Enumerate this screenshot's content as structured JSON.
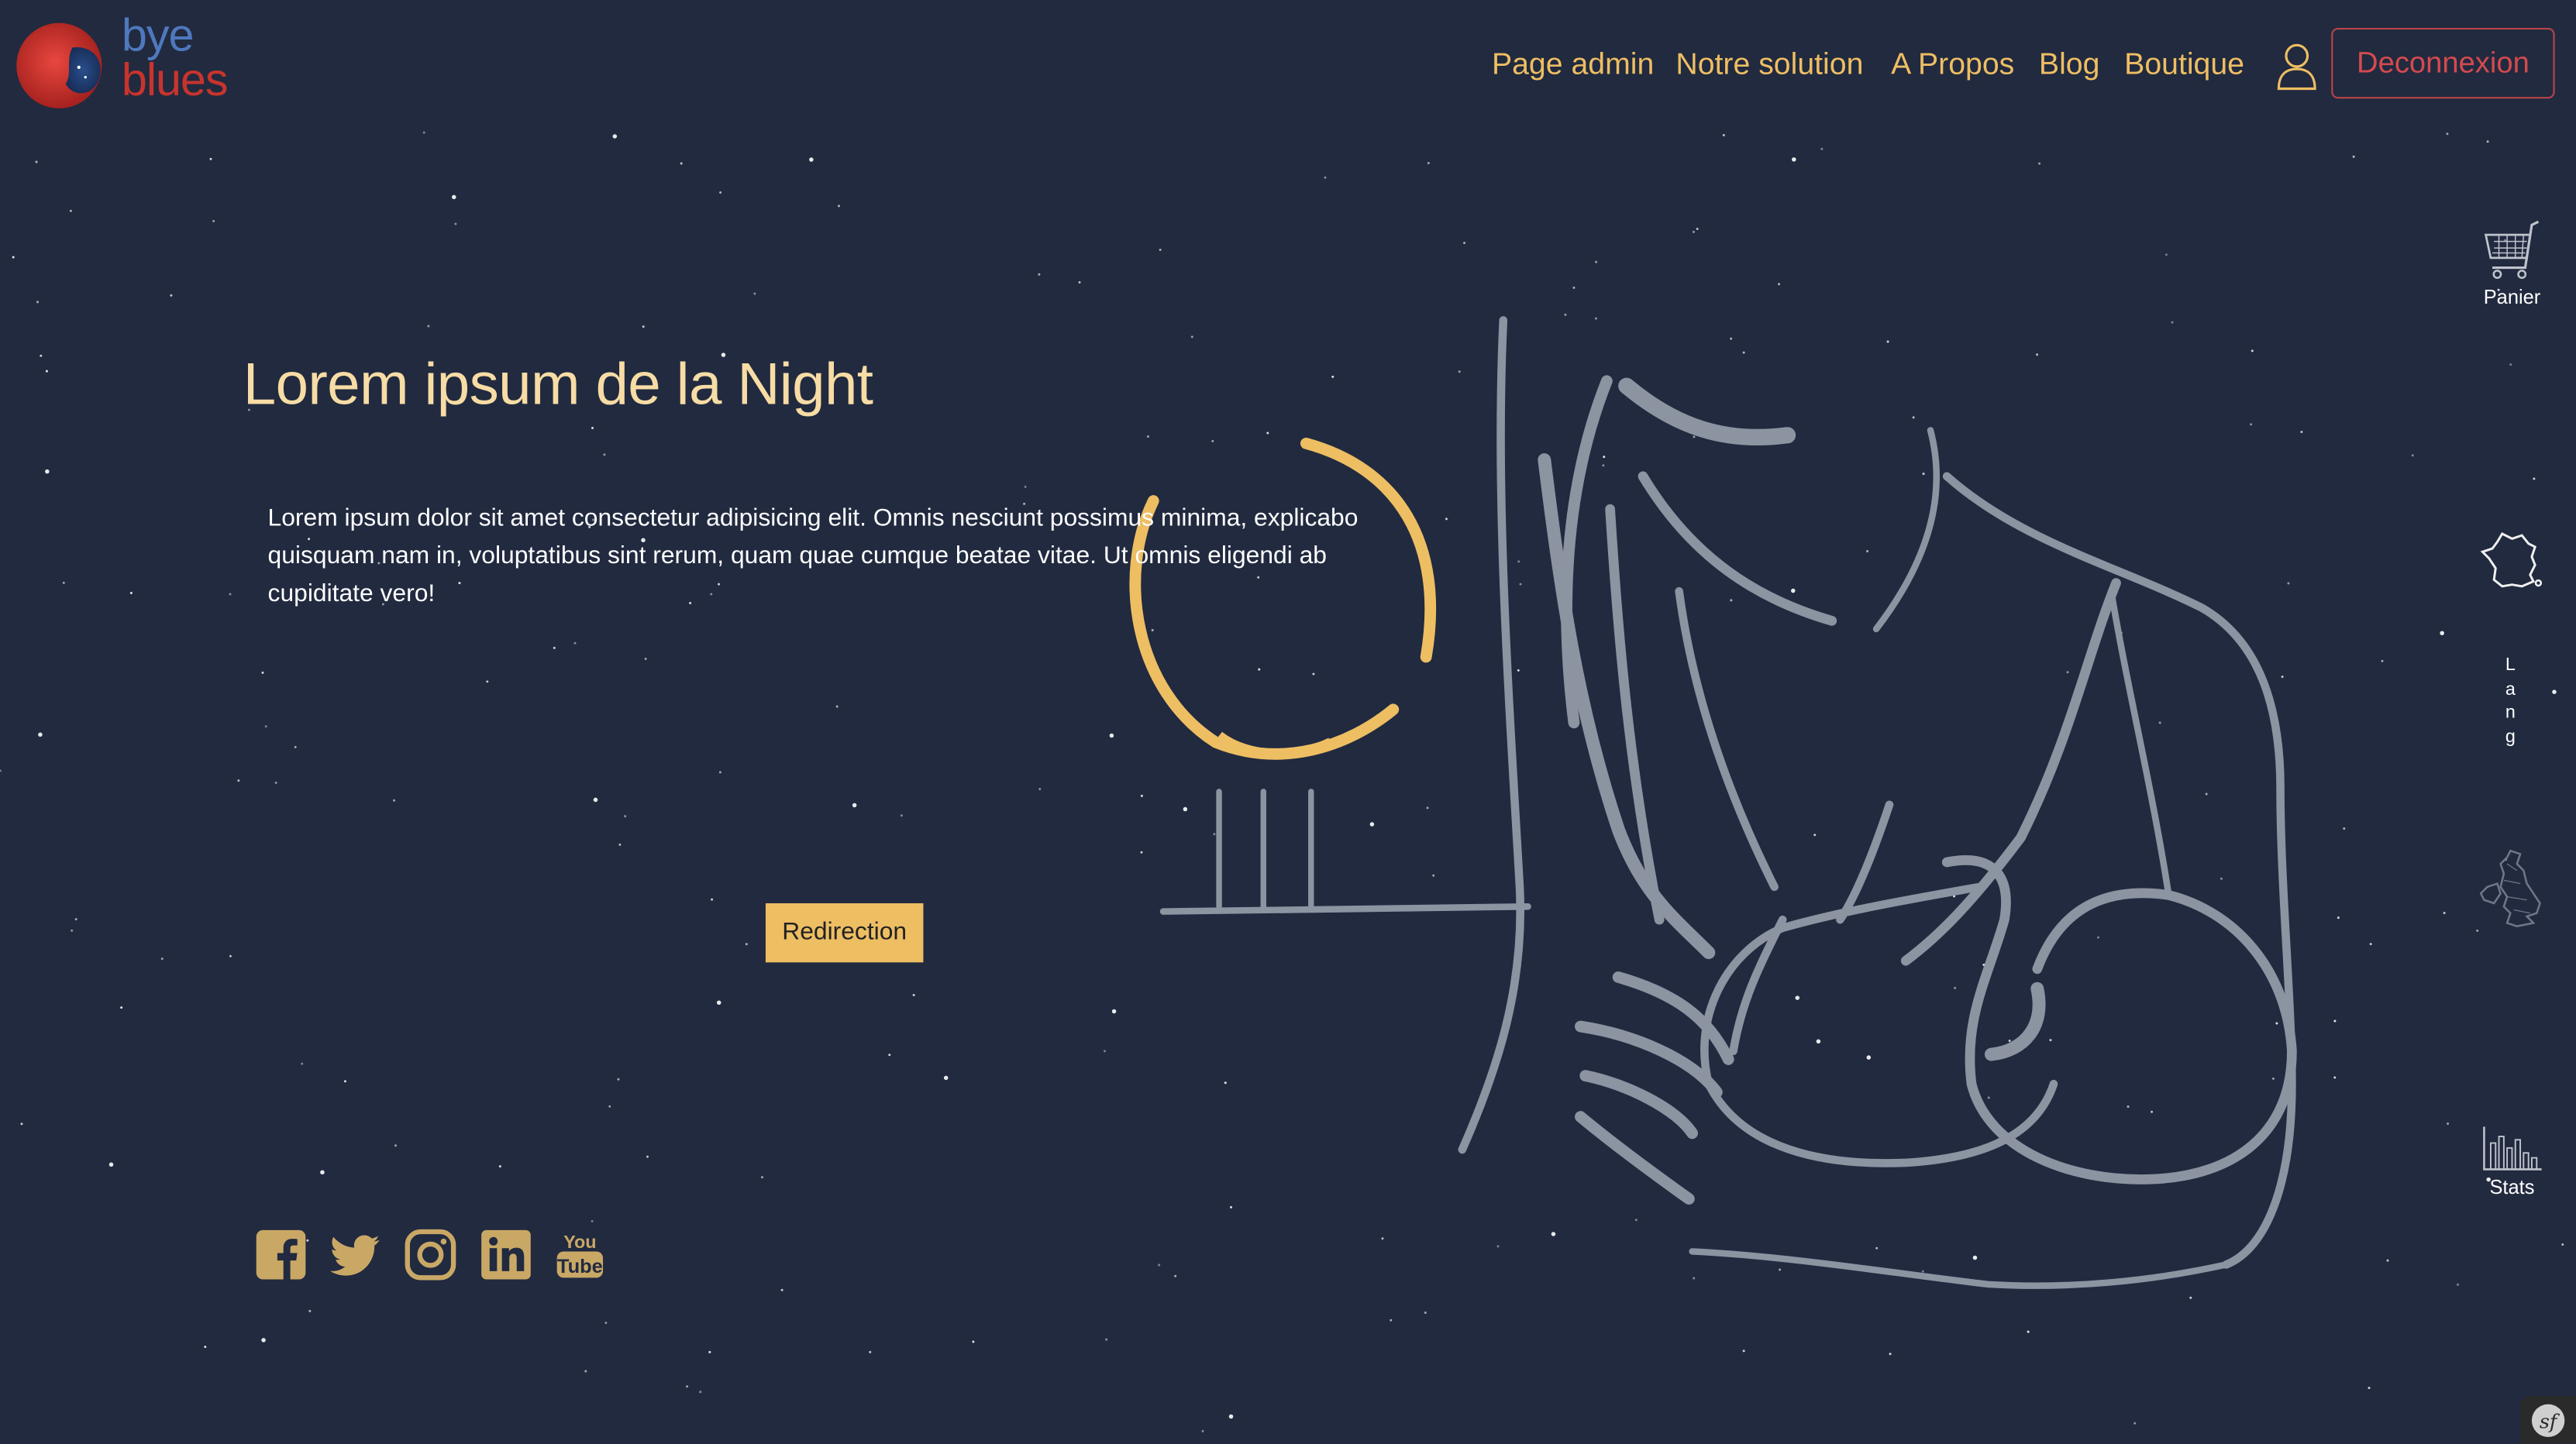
{
  "brand": {
    "line1": "bye",
    "line2": "blues"
  },
  "nav": {
    "items": [
      {
        "label": "Page admin"
      },
      {
        "label": "Notre solution"
      },
      {
        "label": "A Propos"
      },
      {
        "label": "Blog"
      },
      {
        "label": "Boutique"
      }
    ],
    "logout_label": "Deconnexion"
  },
  "sidebar": {
    "cart_label": "Panier",
    "lang_letters": [
      "L",
      "a",
      "n",
      "g"
    ],
    "stats_label": "Stats"
  },
  "hero": {
    "title": "Lorem ipsum de la Night",
    "text": "Lorem ipsum dolor sit amet consectetur adipisicing elit. Omnis nesciunt possimus minima, explicabo quisquam nam in, voluptatibus sint rerum, quam quae cumque beatae vitae. Ut omnis eligendi ab cupiditate vero!",
    "button_label": "Redirection"
  },
  "socials": [
    "facebook-icon",
    "twitter-icon",
    "instagram-icon",
    "linkedin-icon",
    "youtube-icon"
  ],
  "youtube_glyph": {
    "top": "You",
    "bottom": "Tube"
  },
  "colors": {
    "background": "#212a3f",
    "accent": "#eebe63",
    "title": "#f7dca5",
    "logout": "#d44a4f",
    "illustration": "#8c93a1"
  }
}
